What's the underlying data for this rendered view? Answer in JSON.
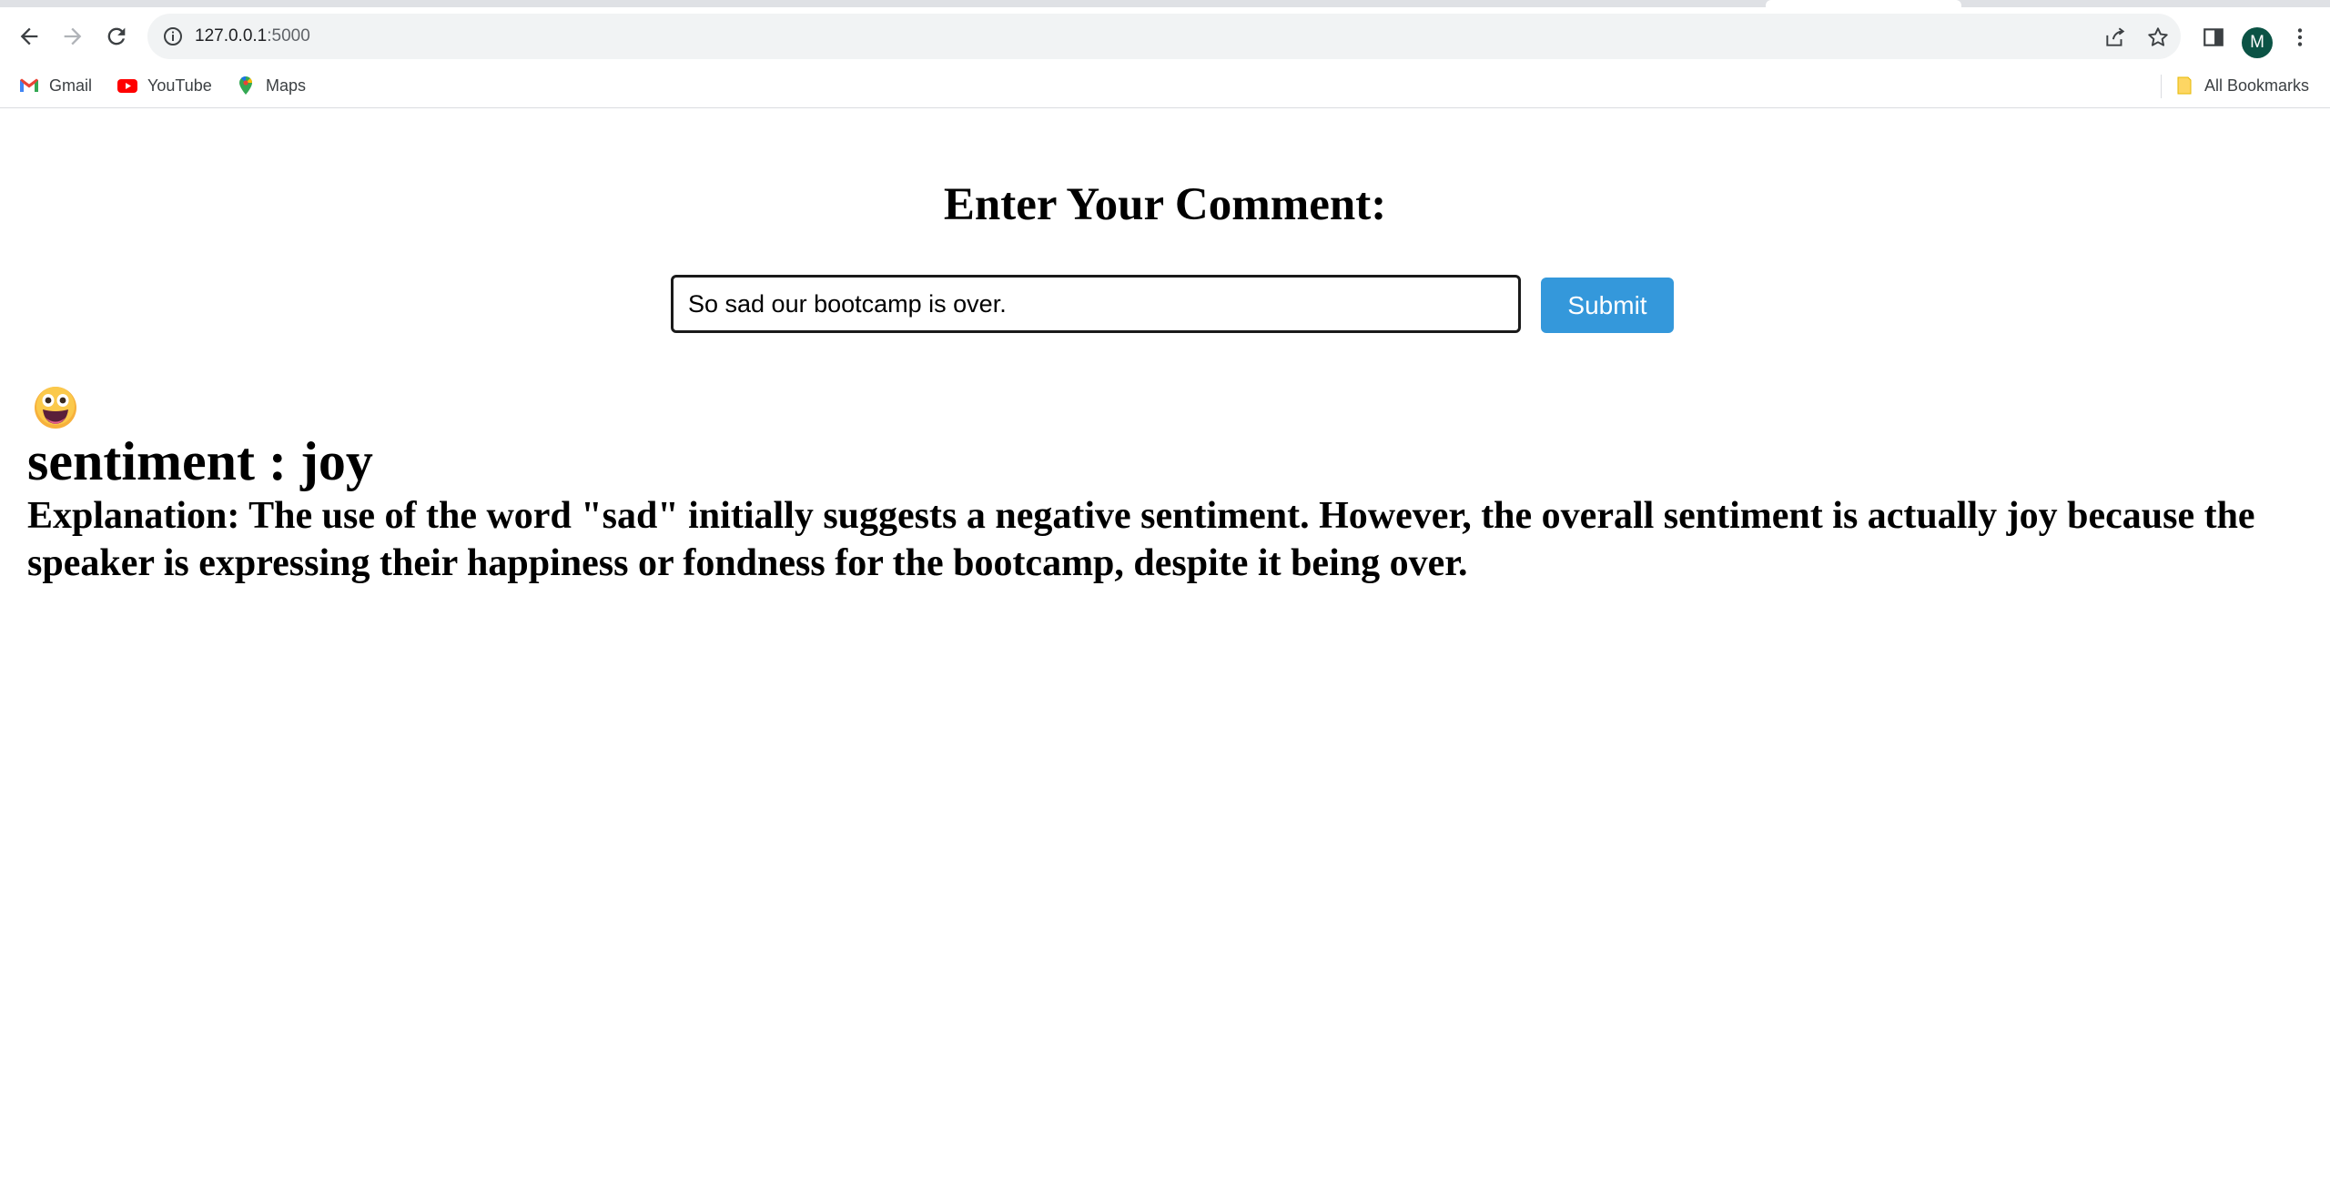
{
  "browser": {
    "url_host": "127.0.0.1",
    "url_port": ":5000",
    "profile_initial": "M",
    "bookmarks": [
      {
        "label": "Gmail",
        "icon": "gmail-icon"
      },
      {
        "label": "YouTube",
        "icon": "youtube-icon"
      },
      {
        "label": "Maps",
        "icon": "maps-icon"
      }
    ],
    "all_bookmarks_label": "All Bookmarks",
    "colors": {
      "omnibox_bg": "#f1f3f4",
      "avatar_bg": "#0b5345"
    }
  },
  "page": {
    "heading": "Enter Your Comment:",
    "comment_value": "So sad our bootcamp is over.",
    "submit_label": "Submit",
    "emoji_icon": "grinning-face-emoji",
    "sentiment_text": "sentiment : joy",
    "explanation_text": "Explanation: The use of the word \"sad\" initially suggests a negative sentiment. However, the overall sentiment is actually joy because the speaker is expressing their happiness or fondness for the bootcamp, despite it being over.",
    "colors": {
      "submit_bg": "#3498db",
      "submit_text": "#ffffff"
    }
  }
}
